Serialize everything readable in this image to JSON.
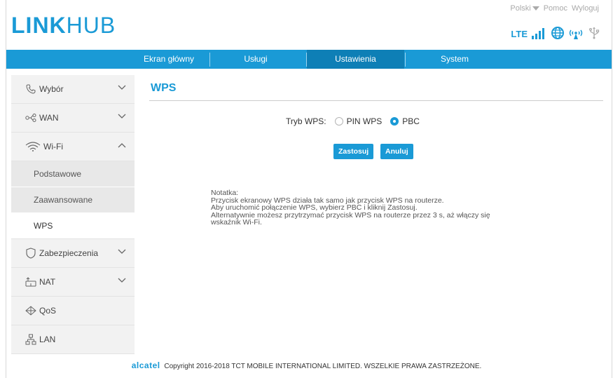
{
  "brand": {
    "logo_bold": "LINK",
    "logo_thin": "HUB"
  },
  "topnav": {
    "language": "Polski",
    "help": "Pomoc",
    "logout": "Wyloguj"
  },
  "status": {
    "network": "LTE"
  },
  "navbar": {
    "items": [
      {
        "label": "Ekran główny"
      },
      {
        "label": "Usługi"
      },
      {
        "label": "Ustawienia"
      },
      {
        "label": "System"
      }
    ],
    "active": "Ustawienia"
  },
  "sidebar": {
    "items": [
      {
        "label": "Wybór"
      },
      {
        "label": "WAN"
      },
      {
        "label": "Wi-Fi"
      },
      {
        "label": "Zabezpieczenia"
      },
      {
        "label": "NAT"
      },
      {
        "label": "QoS"
      },
      {
        "label": "LAN"
      }
    ],
    "wifi_sub": [
      {
        "label": "Podstawowe"
      },
      {
        "label": "Zaawansowane"
      },
      {
        "label": "WPS"
      }
    ],
    "active_sub": "WPS"
  },
  "main": {
    "title": "WPS",
    "mode_label": "Tryb WPS:",
    "options": [
      {
        "label": "PIN WPS",
        "selected": false
      },
      {
        "label": "PBC",
        "selected": true
      }
    ],
    "apply_label": "Zastosuj",
    "cancel_label": "Anuluj",
    "notes": [
      "Notatka:",
      "Przycisk ekranowy WPS działa tak samo jak przycisk WPS na routerze.",
      "Aby uruchomić połączenie WPS, wybierz PBC i kliknij Zastosuj.",
      "Alternatywnie możesz przytrzymać przycisk WPS na routerze przez 3 s, aż włączy się",
      "wskaźnik Wi-Fi."
    ]
  },
  "footer": {
    "brand": "alcatel",
    "copyright": "Copyright 2016-2018 TCT MOBILE INTERNATIONAL LIMITED. WSZELKIE PRAWA ZASTRZEŻONE."
  },
  "colors": {
    "accent": "#1a9ad6",
    "nav_active": "#0e7fb6",
    "sidebar_bg": "#f2f2f2"
  },
  "icons": {
    "sidebar": [
      "phone-icon",
      "wan-icon",
      "wifi-icon",
      "shield-icon",
      "nat-icon",
      "qos-icon",
      "lan-icon"
    ],
    "status": [
      "signal-icon",
      "globe-icon",
      "wps-icon",
      "usb-icon"
    ]
  }
}
